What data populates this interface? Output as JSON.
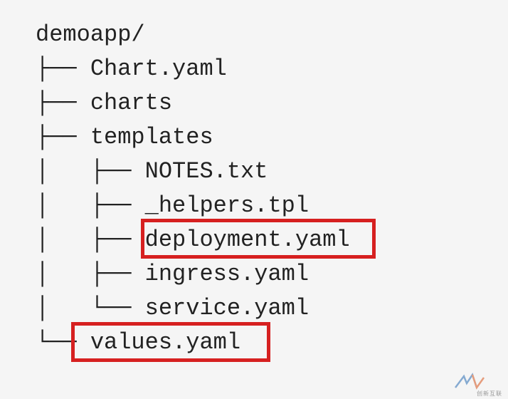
{
  "tree": {
    "root": "demoapp/",
    "lines": [
      "├── Chart.yaml",
      "├── charts",
      "├── templates",
      "│   ├── NOTES.txt",
      "│   ├── _helpers.tpl",
      "│   ├── deployment.yaml",
      "│   ├── ingress.yaml",
      "│   └── service.yaml",
      "└── values.yaml"
    ]
  },
  "highlighted_files": [
    "deployment.yaml",
    "values.yaml"
  ],
  "watermark_text": "创新互联"
}
